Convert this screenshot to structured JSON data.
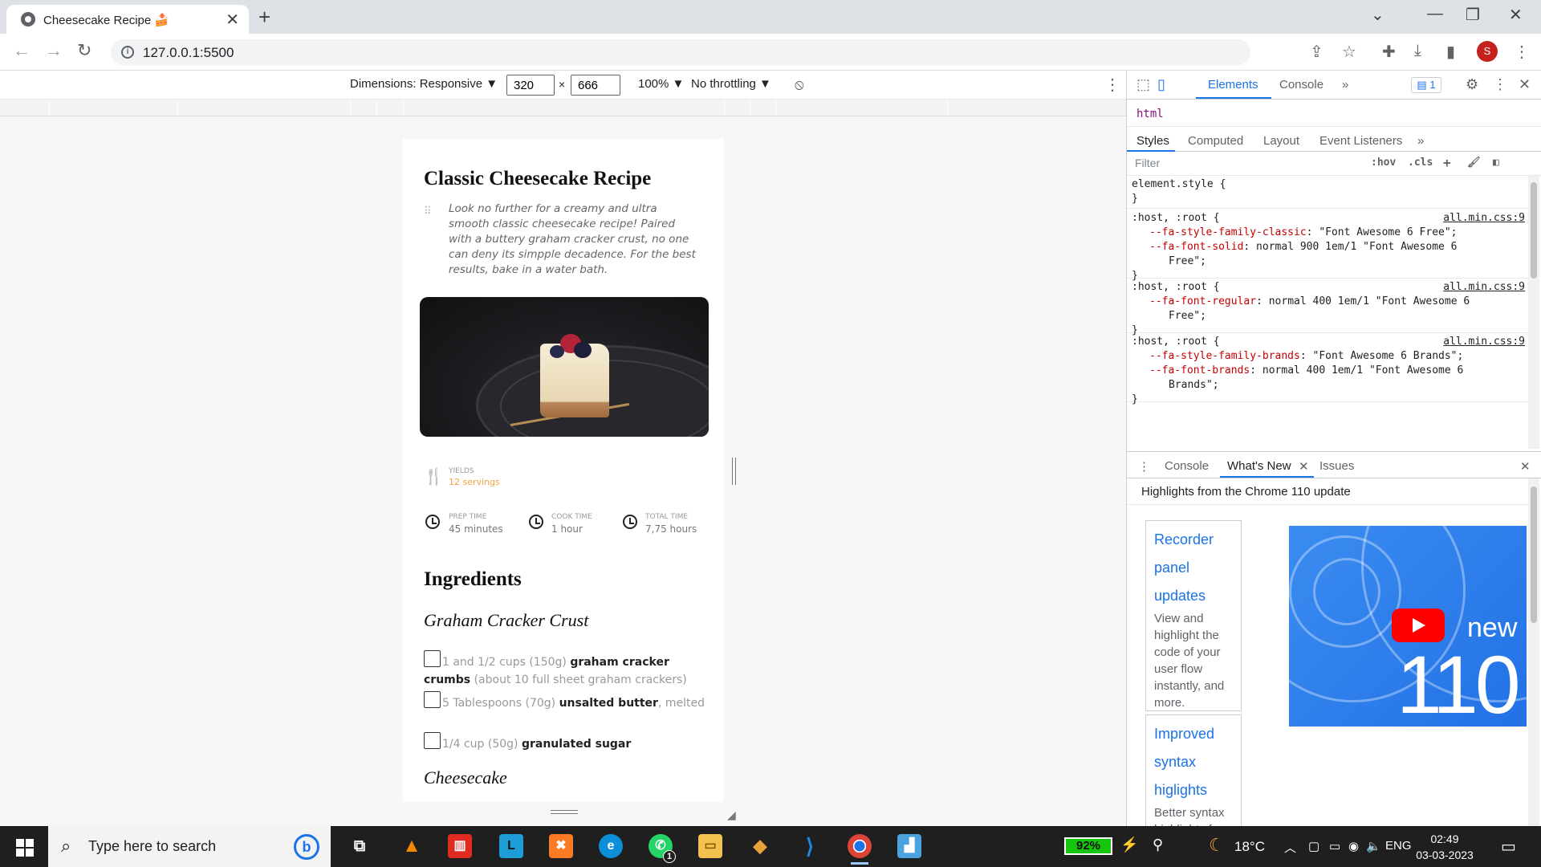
{
  "browser": {
    "tab_title": "Cheesecake Recipe 🍰",
    "tab_close": "✕",
    "new_tab": "+",
    "url": "127.0.0.1:5500",
    "avatar": "S"
  },
  "device_toolbar": {
    "dimensions_label": "Dimensions: Responsive ▼",
    "width": "320",
    "height": "666",
    "times": "×",
    "zoom": "100% ▼",
    "throttling": "No throttling ▼"
  },
  "recipe": {
    "title": "Classic Cheesecake Recipe",
    "intro": "Look no further for a creamy and ultra smooth classic cheesecake recipe! Paired with a buttery graham cracker crust, no one can deny its simpple decadence. For the best results, bake in a water bath.",
    "yields_label": "YIELDS",
    "yields_value": "12 servings",
    "prep_label": "PREP TIME",
    "prep_value": "45 minutes",
    "cook_label": "COOK TIME",
    "cook_value": "1 hour",
    "total_label": "TOTAL TIME",
    "total_value": "7,75 hours",
    "ingredients_heading": "Ingredients",
    "crust_heading": "Graham Cracker Crust",
    "cheesecake_heading": "Cheesecake",
    "ingredients": [
      {
        "amount": "1 and 1/2 cups (150g) ",
        "item": "graham cracker crumbs",
        "note": " (about 10 full sheet graham crackers)"
      },
      {
        "amount": "5 Tablespoons (70g) ",
        "item": "unsalted butter",
        "note": ", melted"
      },
      {
        "amount": "1/4 cup (50g) ",
        "item": "granulated sugar",
        "note": ""
      }
    ]
  },
  "devtools": {
    "tabs": [
      "Elements",
      "Console",
      "»"
    ],
    "issues_badge": "1",
    "breadcrumb": "html",
    "sub_tabs": [
      "Styles",
      "Computed",
      "Layout",
      "Event Listeners",
      "»"
    ],
    "filter_placeholder": "Filter",
    "hov": ":hov",
    "cls": ".cls",
    "element_style_open": "element.style {",
    "close_brace": "}",
    "rules": [
      {
        "selector": ":host, :root {",
        "source": "all.min.css:9",
        "props": [
          {
            "name": "--fa-style-family-classic",
            "value": ": \"Font Awesome 6 Free\";",
            "cont": ""
          },
          {
            "name": "--fa-font-solid",
            "value": ": normal 900 1em/1 \"Font Awesome 6",
            "cont": "Free\";"
          }
        ]
      },
      {
        "selector": ":host, :root {",
        "source": "all.min.css:9",
        "props": [
          {
            "name": "--fa-font-regular",
            "value": ": normal 400 1em/1 \"Font Awesome 6",
            "cont": "Free\";"
          }
        ]
      },
      {
        "selector": ":host, :root {",
        "source": "all.min.css:9",
        "props": [
          {
            "name": "--fa-style-family-brands",
            "value": ": \"Font Awesome 6 Brands\";",
            "cont": ""
          },
          {
            "name": "--fa-font-brands",
            "value": ": normal 400 1em/1 \"Font Awesome 6",
            "cont": "Brands\";"
          }
        ]
      }
    ],
    "drawer_tabs": [
      "Console",
      "What's New",
      "Issues"
    ],
    "whats_new_heading": "Highlights from the Chrome 110 update",
    "cards": [
      {
        "links": [
          "Recorder",
          "panel",
          "updates"
        ],
        "desc": "View and highlight the code of your user flow instantly, and more."
      },
      {
        "links": [
          "Improved",
          "syntax",
          "higlights"
        ],
        "desc": "Better syntax highlights for"
      }
    ],
    "promo_new": "new",
    "promo_num": "110"
  },
  "taskbar": {
    "search_placeholder": "Type here to search",
    "battery": "92%",
    "temperature": "18°C",
    "language": "ENG",
    "time": "02:49",
    "date": "03-03-2023",
    "whatsapp_count": "1"
  },
  "colors": {
    "accent": "#1a73e8",
    "yield_orange": "#f4a340",
    "css_property": "#c80000"
  }
}
